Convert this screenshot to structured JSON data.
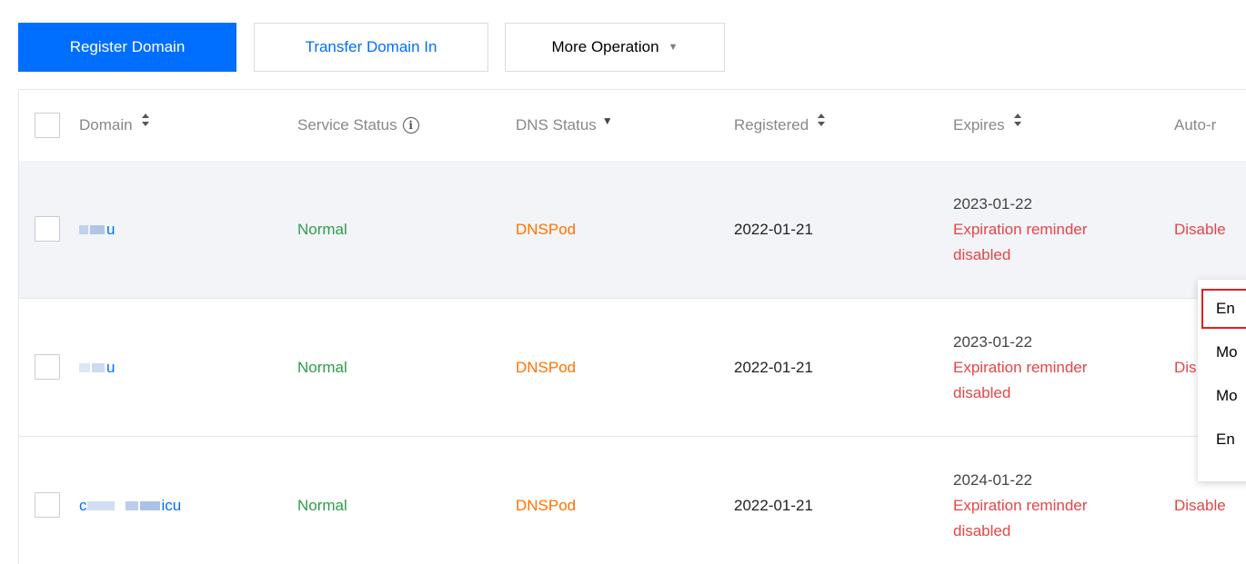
{
  "toolbar": {
    "register_label": "Register Domain",
    "transfer_label": "Transfer Domain In",
    "more_label": "More Operation"
  },
  "table": {
    "columns": {
      "domain": "Domain",
      "service_status": "Service Status",
      "dns_status": "DNS Status",
      "registered": "Registered",
      "expires": "Expires",
      "auto_renew": "Auto-r"
    },
    "rows": [
      {
        "domain_suffix": "u",
        "service_status": "Normal",
        "dns_status": "DNSPod",
        "registered": "2022-01-21",
        "expires_date": "2023-01-22",
        "expires_note_line1": "Expiration reminder",
        "expires_note_line2": "disabled",
        "auto_renew": "Disable"
      },
      {
        "domain_suffix": "u",
        "service_status": "Normal",
        "dns_status": "DNSPod",
        "registered": "2022-01-21",
        "expires_date": "2023-01-22",
        "expires_note_line1": "Expiration reminder",
        "expires_note_line2": "disabled",
        "auto_renew": "Dis"
      },
      {
        "domain_prefix": "c",
        "domain_suffix": "icu",
        "service_status": "Normal",
        "dns_status": "DNSPod",
        "registered": "2022-01-21",
        "expires_date": "2024-01-22",
        "expires_note_line1": "Expiration reminder",
        "expires_note_line2": "disabled",
        "auto_renew": "Disable"
      }
    ]
  },
  "dropdown": {
    "items": [
      "En",
      "Mo",
      "Mo",
      "En"
    ]
  },
  "colors": {
    "primary": "#006eff",
    "normal": "#2e9d4b",
    "dns": "#ff7200",
    "warning": "#e54545",
    "highlight": "#e02020"
  },
  "icons": {
    "sort": "sort-icon",
    "filter": "filter-icon",
    "info": "info-icon",
    "dropdown_caret": "caret-down-icon"
  }
}
